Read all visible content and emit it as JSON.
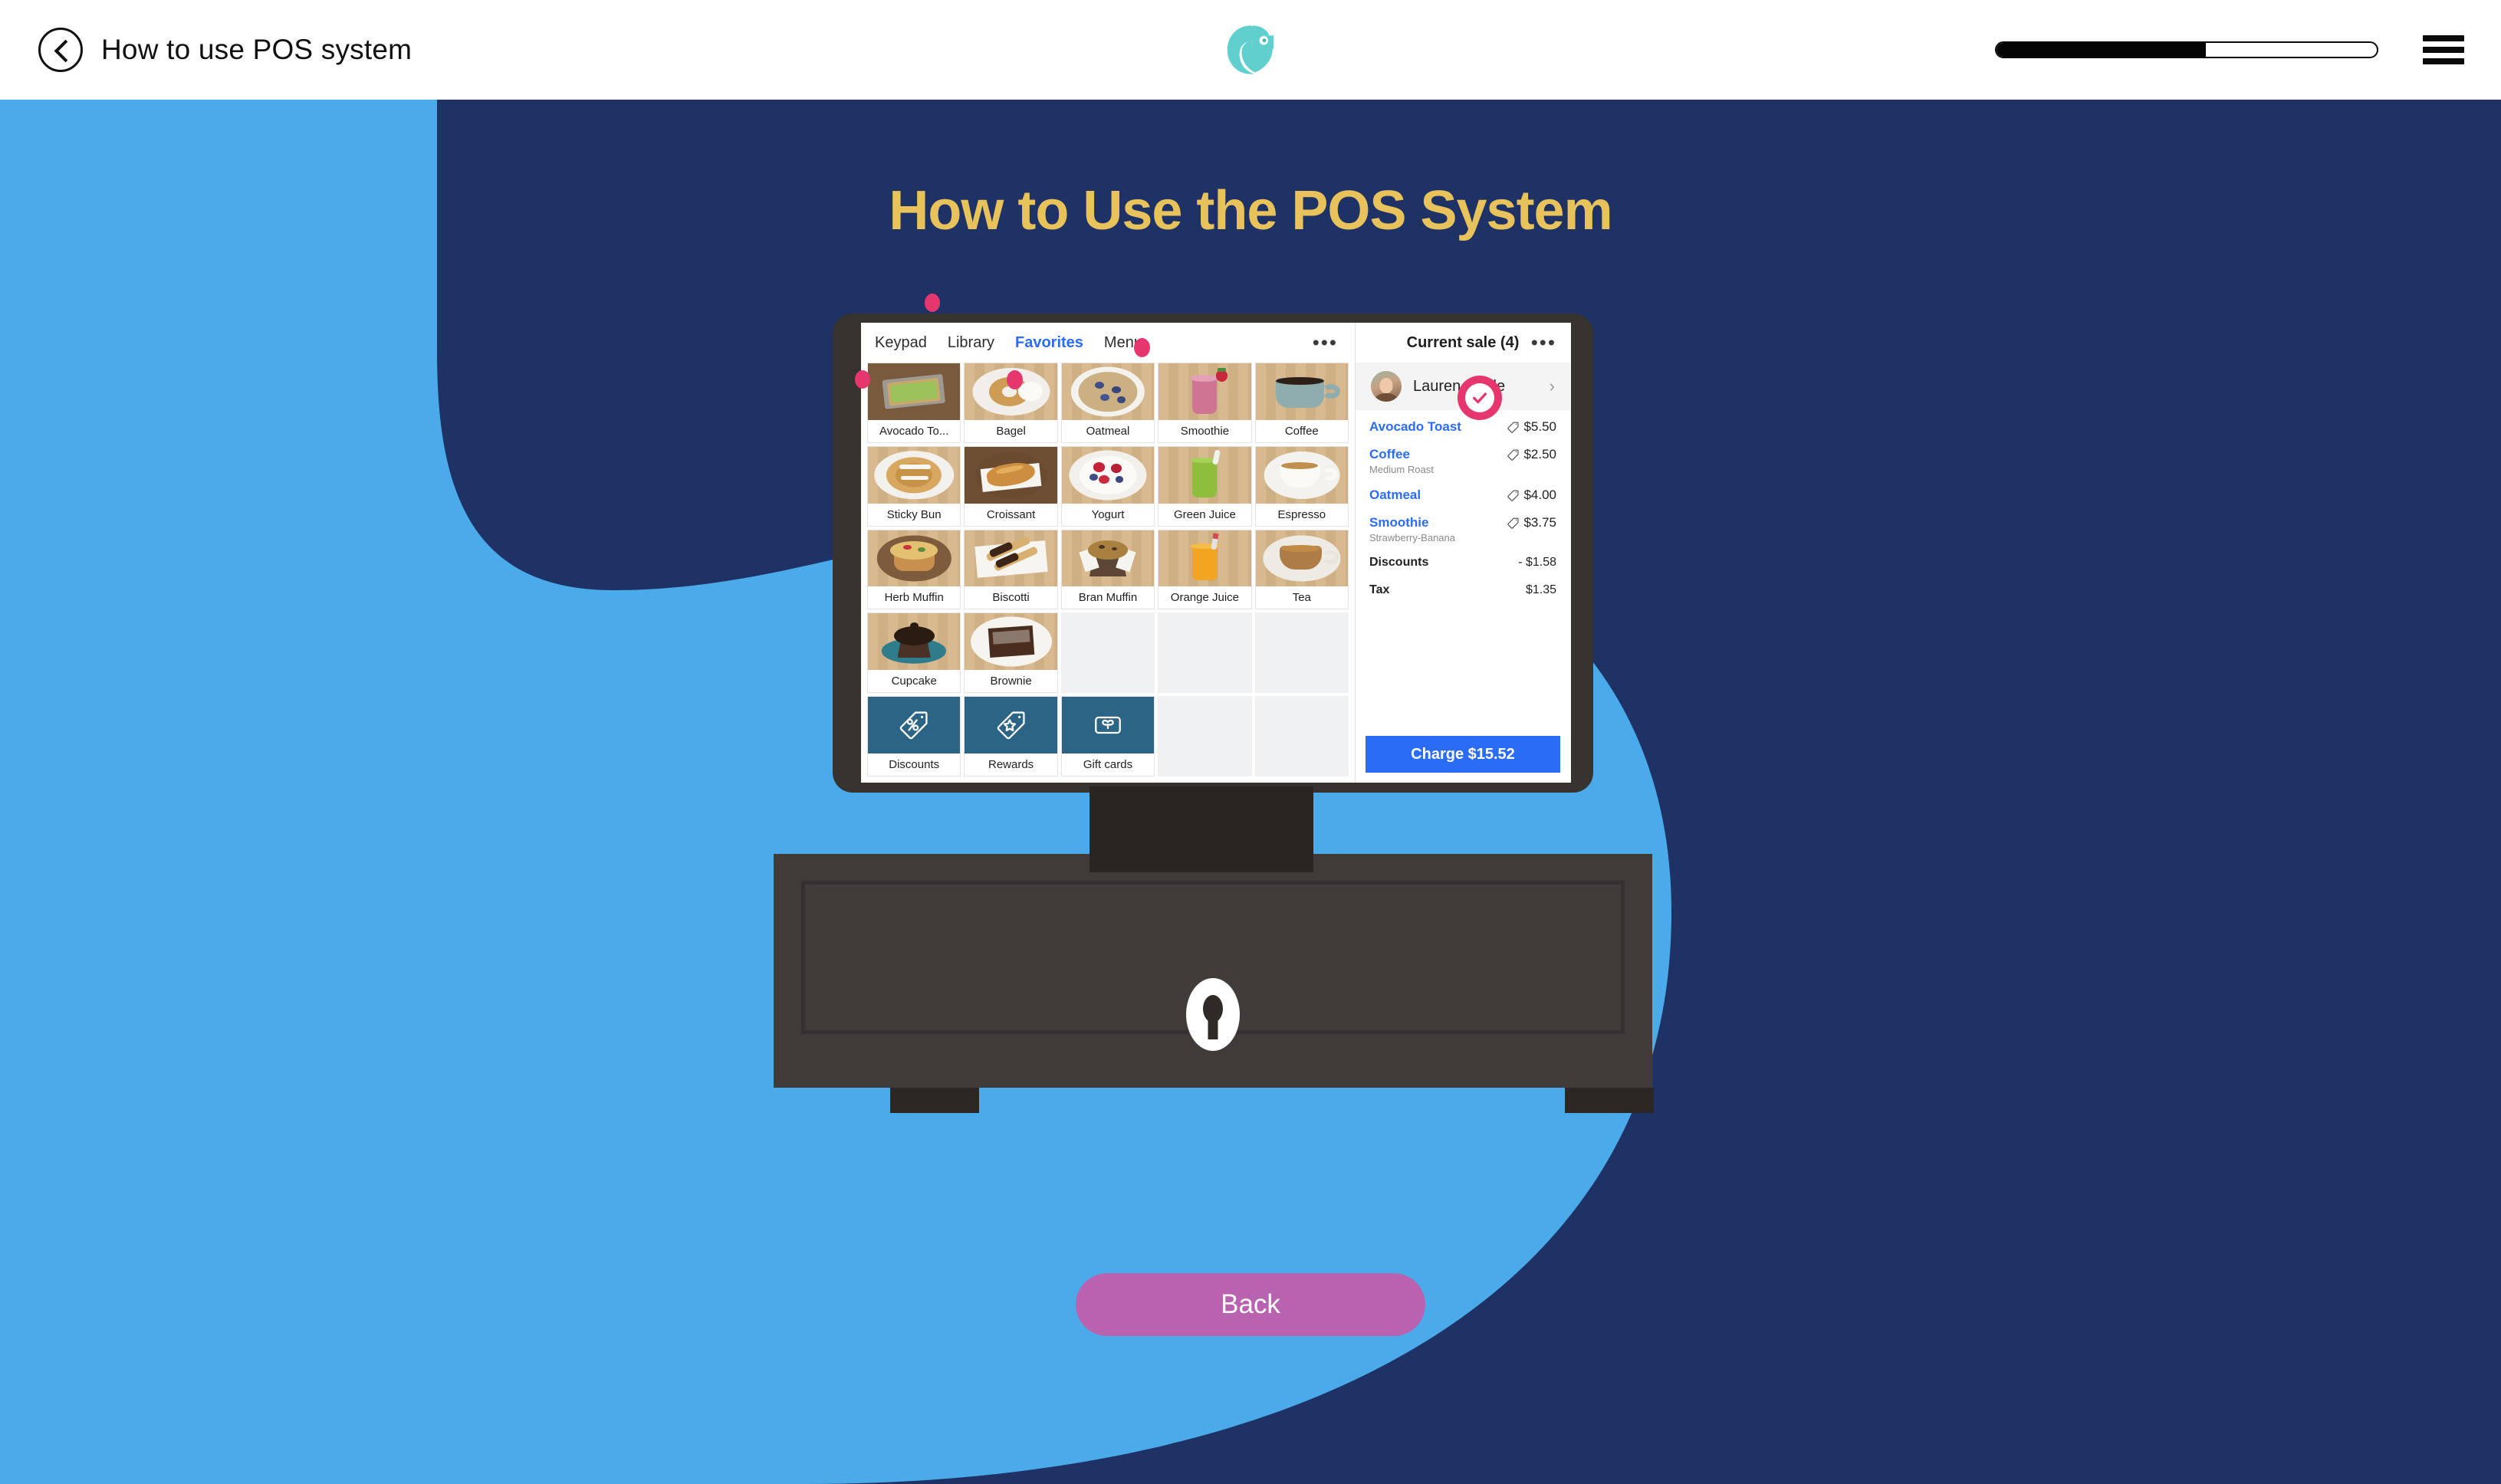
{
  "header": {
    "back_label": "How to use POS system",
    "back_icon": "chevron-left-icon",
    "logo_icon": "chameleon-logo-icon",
    "menu_icon": "hamburger-menu-icon",
    "progress_percent": 55
  },
  "page": {
    "title": "How to Use the POS System",
    "back_button_label": "Back"
  },
  "colors": {
    "light_blue": "#4BABEA",
    "navy": "#1F3265",
    "gold": "#E8C35B",
    "pink": "#E5376D",
    "purple": "#B862B0",
    "pos_blue": "#2B6CF6",
    "action_tile": "#2B6485"
  },
  "pos": {
    "tabs": [
      {
        "label": "Keypad",
        "active": false
      },
      {
        "label": "Library",
        "active": false
      },
      {
        "label": "Favorites",
        "active": true
      },
      {
        "label": "Menu",
        "active": false
      }
    ],
    "tabs_more_icon": "overflow-menu-icon",
    "tiles": [
      {
        "label": "Avocado To...",
        "art": "avocado-toast"
      },
      {
        "label": "Bagel",
        "art": "bagel"
      },
      {
        "label": "Oatmeal",
        "art": "oatmeal"
      },
      {
        "label": "Smoothie",
        "art": "smoothie"
      },
      {
        "label": "Coffee",
        "art": "coffee"
      },
      {
        "label": "Sticky Bun",
        "art": "sticky-bun"
      },
      {
        "label": "Croissant",
        "art": "croissant"
      },
      {
        "label": "Yogurt",
        "art": "yogurt"
      },
      {
        "label": "Green Juice",
        "art": "green-juice"
      },
      {
        "label": "Espresso",
        "art": "espresso"
      },
      {
        "label": "Herb Muffin",
        "art": "herb-muffin"
      },
      {
        "label": "Biscotti",
        "art": "biscotti"
      },
      {
        "label": "Bran Muffin",
        "art": "bran-muffin"
      },
      {
        "label": "Orange Juice",
        "art": "orange-juice"
      },
      {
        "label": "Tea",
        "art": "tea"
      },
      {
        "label": "Cupcake",
        "art": "cupcake"
      },
      {
        "label": "Brownie",
        "art": "brownie"
      },
      {
        "label": "",
        "art": "empty"
      },
      {
        "label": "",
        "art": "empty"
      },
      {
        "label": "",
        "art": "empty"
      },
      {
        "label": "Discounts",
        "art": "action",
        "icon": "percent-tag-icon"
      },
      {
        "label": "Rewards",
        "art": "action",
        "icon": "star-tag-icon"
      },
      {
        "label": "Gift cards",
        "art": "action",
        "icon": "gift-card-icon"
      },
      {
        "label": "",
        "art": "empty"
      },
      {
        "label": "",
        "art": "empty"
      }
    ],
    "sale": {
      "title": "Current sale (4)",
      "more_icon": "overflow-menu-icon",
      "customer": {
        "name": "Lauren Noble",
        "avatar_icon": "customer-avatar",
        "chevron_icon": "chevron-right-icon"
      },
      "items": [
        {
          "name": "Avocado Toast",
          "price": "$5.50",
          "modifier": "",
          "tag_icon": "price-tag-icon"
        },
        {
          "name": "Coffee",
          "price": "$2.50",
          "modifier": "Medium Roast",
          "tag_icon": "price-tag-icon"
        },
        {
          "name": "Oatmeal",
          "price": "$4.00",
          "modifier": "",
          "tag_icon": "price-tag-icon"
        },
        {
          "name": "Smoothie",
          "price": "$3.75",
          "modifier": "Strawberry-Banana",
          "tag_icon": "price-tag-icon"
        }
      ],
      "totals": [
        {
          "label": "Discounts",
          "value": "- $1.58"
        },
        {
          "label": "Tax",
          "value": "$1.35"
        }
      ],
      "charge_label": "Charge $15.52"
    }
  },
  "hardware": {
    "cash_drawer_icon": "keyhole-icon"
  }
}
